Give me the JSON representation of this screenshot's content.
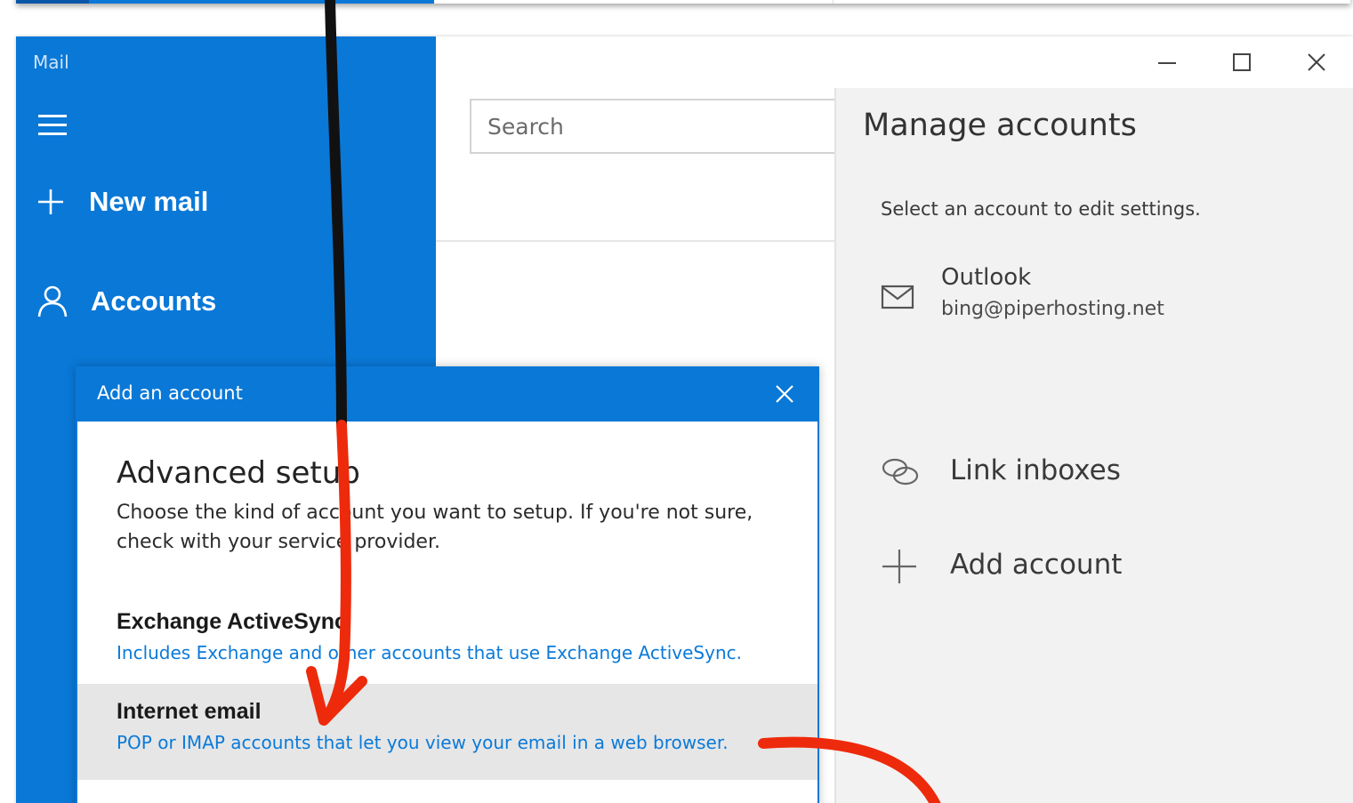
{
  "app": {
    "title": "Mail"
  },
  "sidebar": {
    "new_mail_label": "New mail",
    "accounts_label": "Accounts"
  },
  "search": {
    "placeholder": "Search"
  },
  "manage_accounts": {
    "title": "Manage accounts",
    "subtitle": "Select an account to edit settings.",
    "account": {
      "name": "Outlook",
      "email": "bing@piperhosting.net"
    },
    "link_inboxes_label": "Link inboxes",
    "add_account_label": "Add account"
  },
  "dialog": {
    "title": "Add an account",
    "heading": "Advanced setup",
    "description": "Choose the kind of account you want to setup. If you're not sure, check with your service provider.",
    "options": [
      {
        "title": "Exchange ActiveSync",
        "description": "Includes Exchange and other accounts that use Exchange ActiveSync."
      },
      {
        "title": "Internet email",
        "description": "POP or IMAP accounts that let you view your email in a web browser."
      }
    ]
  },
  "colors": {
    "accent": "#0a78d7",
    "link": "#0a7ad9",
    "annotation": "#ee2a0c"
  }
}
